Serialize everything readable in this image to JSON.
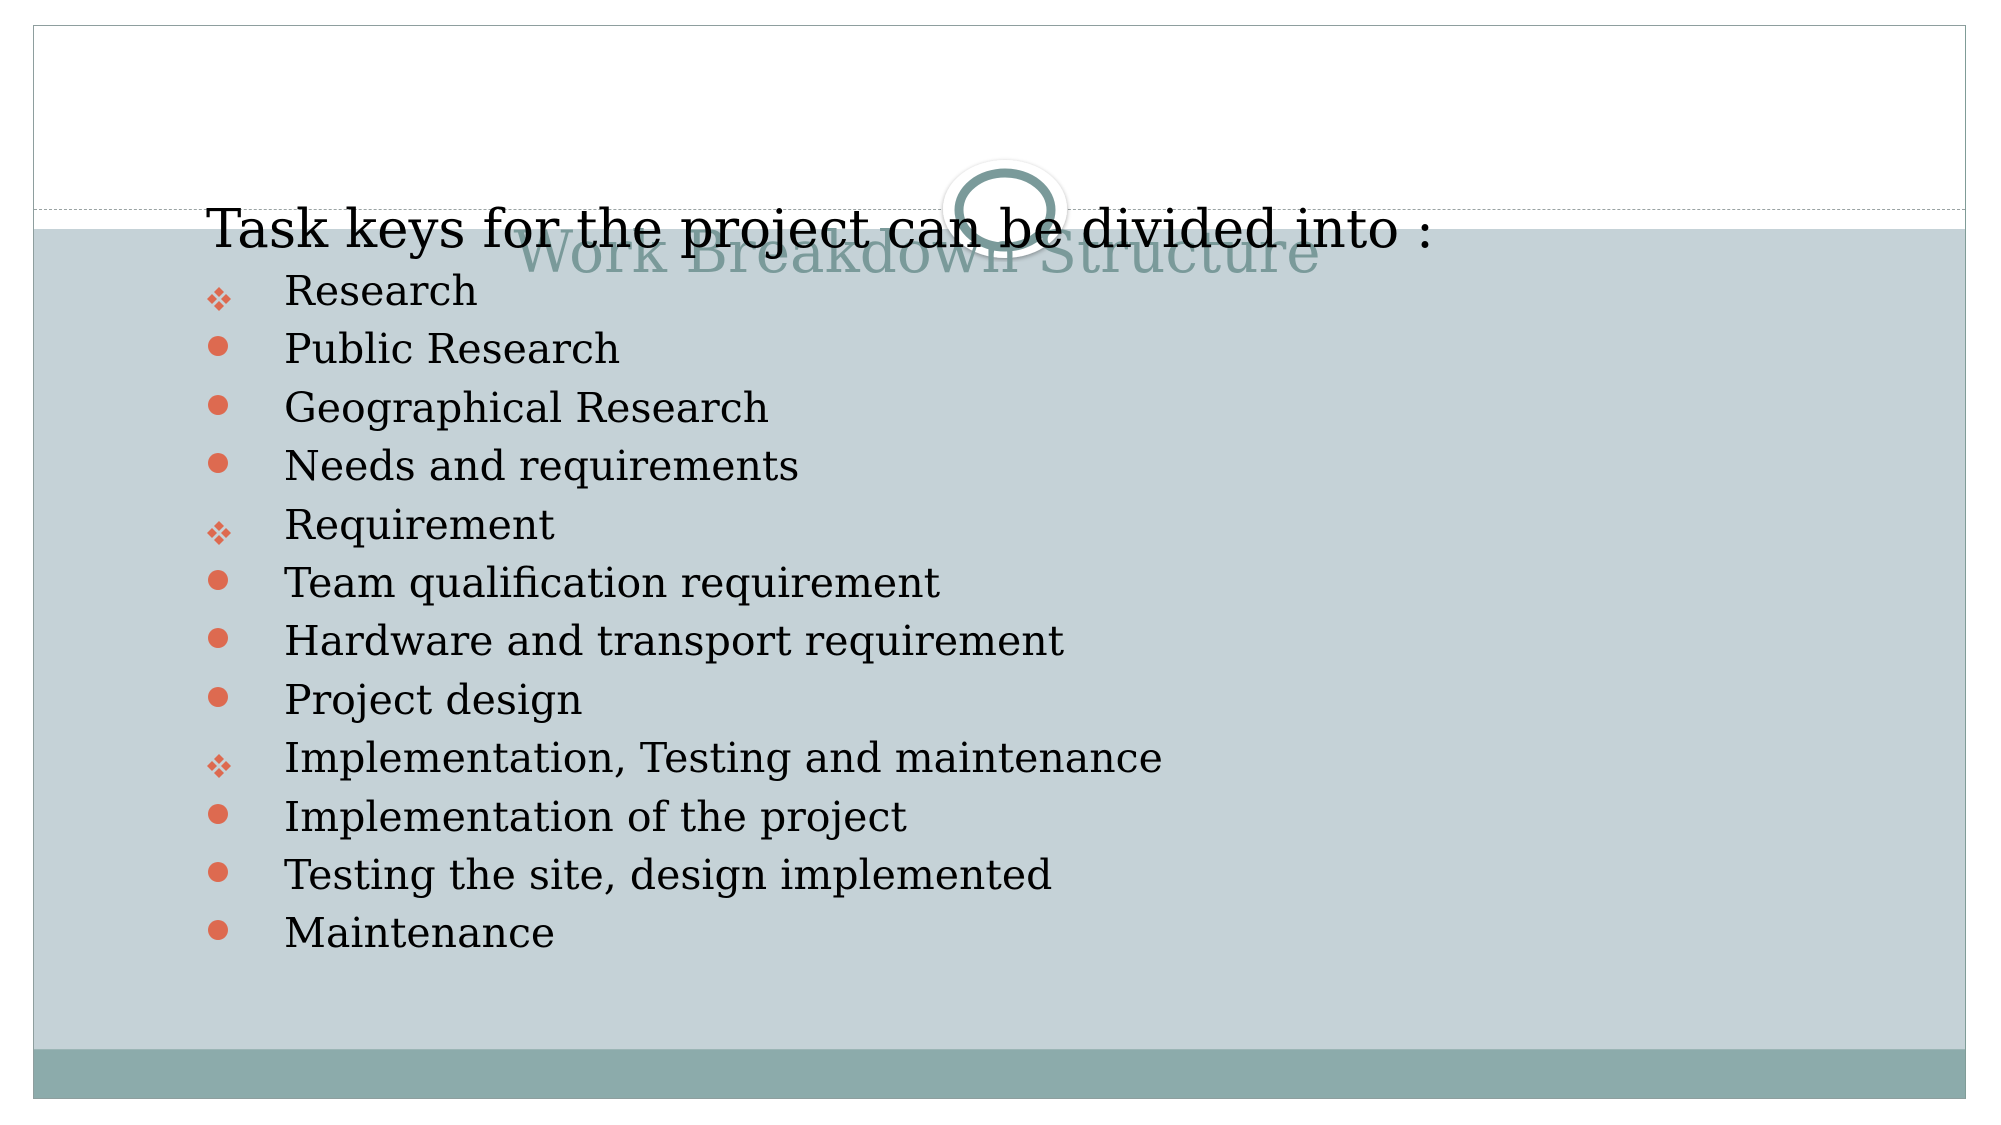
{
  "slide": {
    "title": "Work Breakdown Structure",
    "intro": "Task keys for the project can be divided into :",
    "items": [
      {
        "label": "Research",
        "bullet": "diamond-bullet-icon"
      },
      {
        "label": "Public Research",
        "bullet": "dot-bullet-icon"
      },
      {
        "label": "Geographical Research",
        "bullet": "dot-bullet-icon"
      },
      {
        "label": "Needs and requirements",
        "bullet": "dot-bullet-icon"
      },
      {
        "label": "Requirement",
        "bullet": "diamond-bullet-icon"
      },
      {
        "label": "Team qualification requirement",
        "bullet": "dot-bullet-icon"
      },
      {
        "label": "Hardware and transport requirement",
        "bullet": "dot-bullet-icon"
      },
      {
        "label": "Project design",
        "bullet": "dot-bullet-icon"
      },
      {
        "label": "Implementation, Testing and maintenance",
        "bullet": "diamond-bullet-icon"
      },
      {
        "label": "Implementation of the project",
        "bullet": "dot-bullet-icon"
      },
      {
        "label": "Testing the site, design implemented",
        "bullet": "dot-bullet-icon"
      },
      {
        "label": "Maintenance",
        "bullet": "dot-bullet-icon"
      }
    ]
  },
  "colors": {
    "body_background": "#c5d2d7",
    "footer_band": "#8cabab",
    "title_color": "#7a9a9a",
    "bullet_accent": "#dd6a50",
    "ornament_ring": "#7a9a9a"
  }
}
